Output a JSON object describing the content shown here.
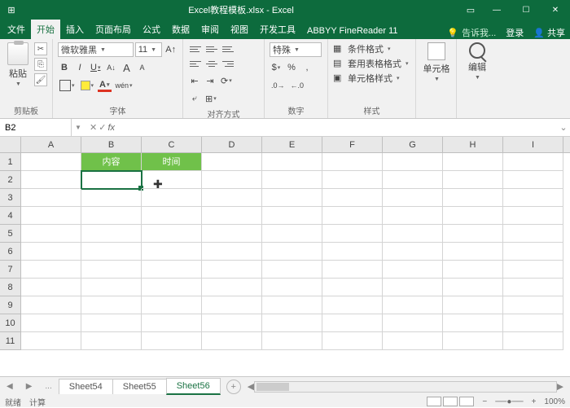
{
  "title": "Excel教程模板.xlsx - Excel",
  "tabs": {
    "file": "文件",
    "home": "开始",
    "insert": "插入",
    "layout": "页面布局",
    "formulas": "公式",
    "data": "数据",
    "review": "审阅",
    "view": "视图",
    "dev": "开发工具",
    "addin": "ABBYY FineReader 11",
    "tell": "告诉我...",
    "login": "登录",
    "share": "共享"
  },
  "ribbon": {
    "paste": "粘贴",
    "clipboard": "剪贴板",
    "fontname": "微软雅黑",
    "fontsize": "11",
    "fontgrp": "字体",
    "align": "对齐方式",
    "numfmt": "特殊",
    "numgrp": "数字",
    "cond": "条件格式",
    "table": "套用表格格式",
    "cellstyle": "单元格样式",
    "stylegrp": "样式",
    "cells": "单元格",
    "edit": "编辑"
  },
  "namebox": "B2",
  "columns": [
    "A",
    "B",
    "C",
    "D",
    "E",
    "F",
    "G",
    "H",
    "I"
  ],
  "rows": [
    "1",
    "2",
    "3",
    "4",
    "5",
    "6",
    "7",
    "8",
    "9",
    "10",
    "11"
  ],
  "headers": {
    "b1": "内容",
    "c1": "时间"
  },
  "sheets": {
    "nav": "...",
    "s1": "Sheet54",
    "s2": "Sheet55",
    "s3": "Sheet56"
  },
  "status": {
    "ready": "就绪",
    "calc": "计算",
    "zoom": "100%"
  },
  "chart_data": null
}
